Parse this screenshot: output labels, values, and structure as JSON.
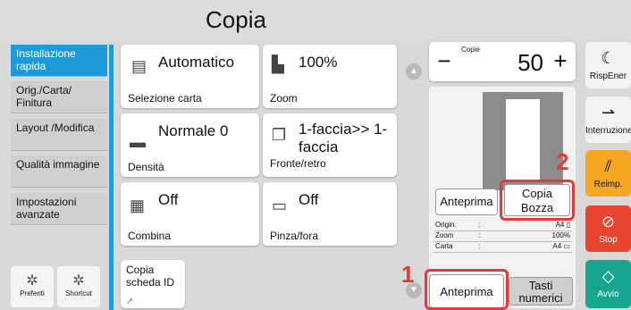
{
  "title": "Copia",
  "sidebar": [
    "Installazione rapida",
    "Orig./Carta/ Finitura",
    "Layout /Modifica",
    "Qualità immagine",
    "Impostazioni avanzate"
  ],
  "favs": [
    "Preferiti",
    "Shortcut"
  ],
  "tiles": {
    "paper_val": "Automatico",
    "paper_lbl": "Selezione carta",
    "zoom_val": "100%",
    "zoom_lbl": "Zoom",
    "density_val": "Normale 0",
    "density_lbl": "Densità",
    "duplex_val": "1-faccia>> 1-faccia",
    "duplex_lbl": "Fronte/retro",
    "combine_val": "Off",
    "combine_lbl": "Combina",
    "staple_val": "Off",
    "staple_lbl": "Pinza/fora",
    "idcopy_lbl": "Copia scheda ID"
  },
  "copies": {
    "label": "Copie",
    "value": "50",
    "minus": "−",
    "plus": "+"
  },
  "preview": {
    "preview_btn": "Anteprima",
    "proof_btn": "Copia Bozza",
    "info": [
      {
        "k": "Origin.",
        "v": "A4 ▯"
      },
      {
        "k": "Zoom",
        "v": "100%"
      },
      {
        "k": "Carta",
        "v": "A4 ▭"
      }
    ],
    "anteprima": "Anteprima",
    "tasti": "Tasti numerici"
  },
  "right": {
    "energy": "RispEner",
    "interrupt": "Interruzione",
    "reset": "Reimp.",
    "stop": "Stop",
    "start": "Avvio"
  },
  "annotations": {
    "one": "1",
    "two": "2"
  },
  "colors": {
    "accent": "#1e9ad6",
    "reset": "#f5a623",
    "stop": "#e8452e",
    "start": "#16a58f",
    "callout": "#e0393e"
  }
}
